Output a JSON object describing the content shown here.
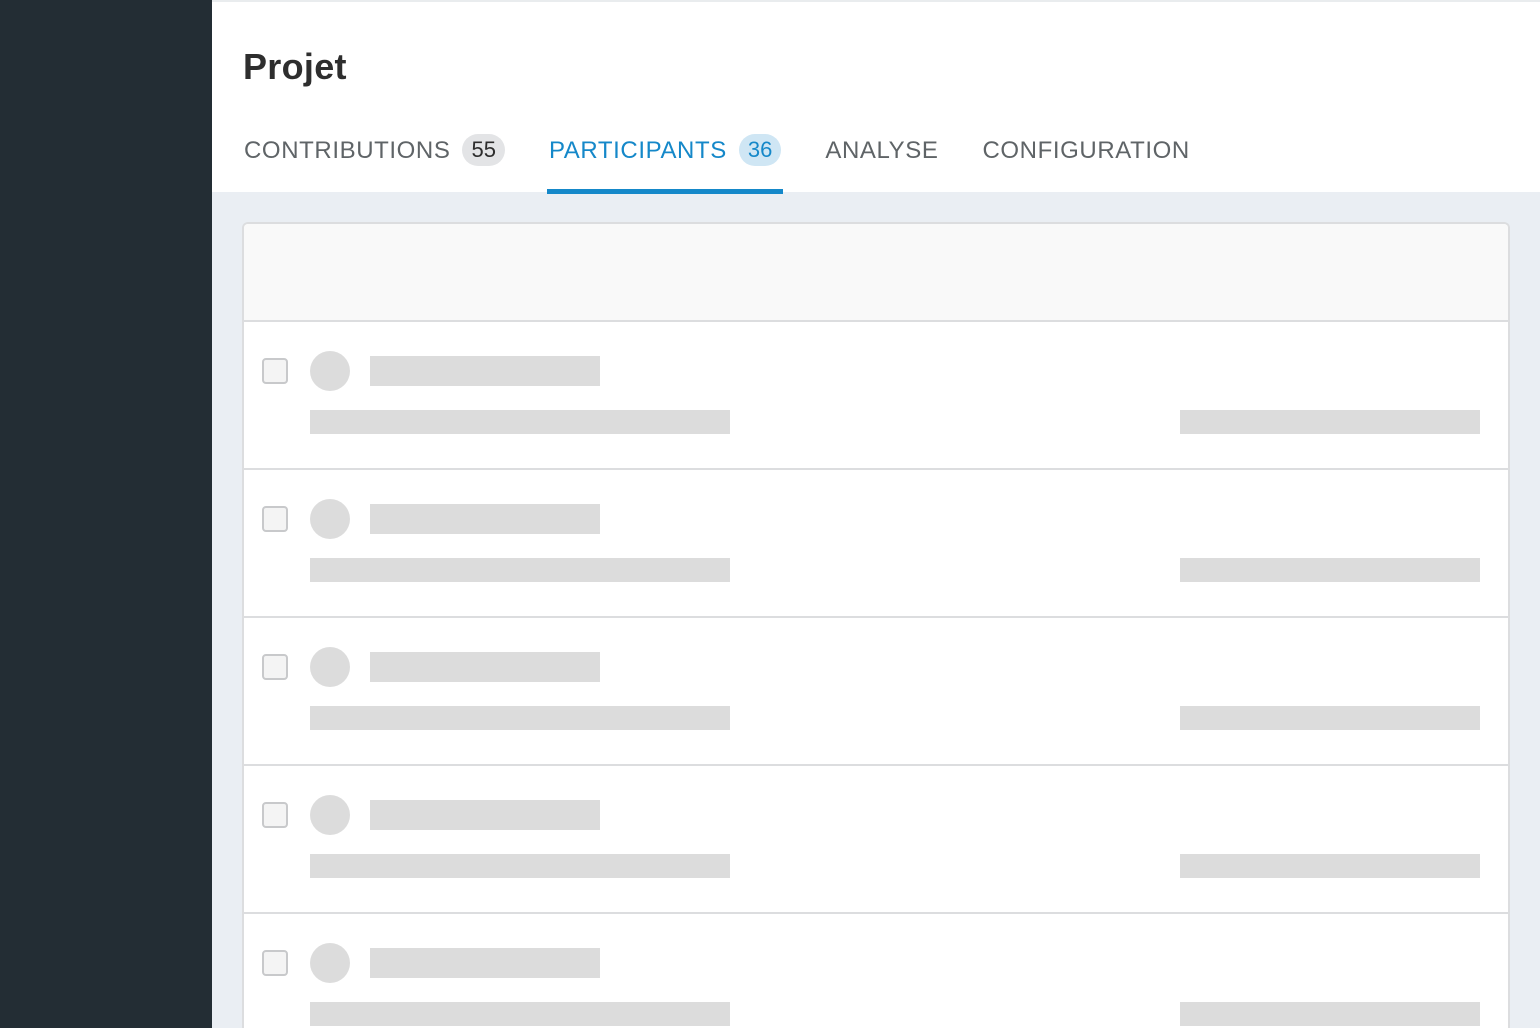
{
  "page": {
    "title": "Projet"
  },
  "tabs": [
    {
      "label": "CONTRIBUTIONS",
      "count": "55",
      "active": false
    },
    {
      "label": "PARTICIPANTS",
      "count": "36",
      "active": true
    },
    {
      "label": "ANALYSE",
      "active": false
    },
    {
      "label": "CONFIGURATION",
      "active": false
    }
  ],
  "participants_list": {
    "loading": true,
    "skeleton_rows": 5
  },
  "colors": {
    "accent": "#1588c9",
    "sidebar": "#232d34",
    "background": "#eaeef3",
    "skeleton": "#dcdcdc"
  }
}
